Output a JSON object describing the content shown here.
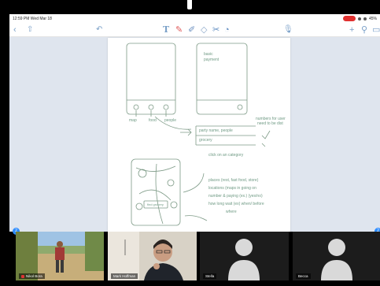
{
  "status_bar": {
    "time": "12:59 PM  Wed Mar 18",
    "battery": "45%"
  },
  "toolbar": {
    "icons": [
      "back-chevron-icon",
      "share-icon",
      "undo-icon",
      "text-tool-icon",
      "pen-icon",
      "highlighter-icon",
      "eraser-icon",
      "lasso-icon",
      "shapes-icon",
      "mic-icon",
      "add-page-icon",
      "search-icon",
      "pages-icon"
    ]
  },
  "sketch": {
    "screen2_text": "basic\npayment",
    "nav_labels": [
      "map",
      "food",
      "people"
    ],
    "list_label_1": "party name, people",
    "list_label_2": "grocery",
    "notes": [
      "numbers for user",
      "need to be dist",
      "click on an category"
    ],
    "map_button": "find grocery",
    "lower_notes": [
      "places (rest, fast food, store)",
      "locations (maps in going on",
      "number & paying (ex.) (yes/no)",
      "how long wait (ex) when/ before",
      "where"
    ]
  },
  "participants": [
    {
      "name": "Nikol Bora",
      "muted": true,
      "kind": "video-beach"
    },
    {
      "name": "Mark Hoffman",
      "muted": false,
      "kind": "video-person"
    },
    {
      "name": "Stella",
      "muted": false,
      "kind": "avatar"
    },
    {
      "name": "Becca",
      "muted": false,
      "kind": "avatar"
    }
  ],
  "gallery_badges": [
    "2",
    "2"
  ],
  "colors": {
    "accent": "#2d8cff",
    "recording": "#e0302f",
    "ink": "#7d9a86",
    "page_bg": "#ffffff",
    "canvas_bg": "#dfe5ee"
  }
}
